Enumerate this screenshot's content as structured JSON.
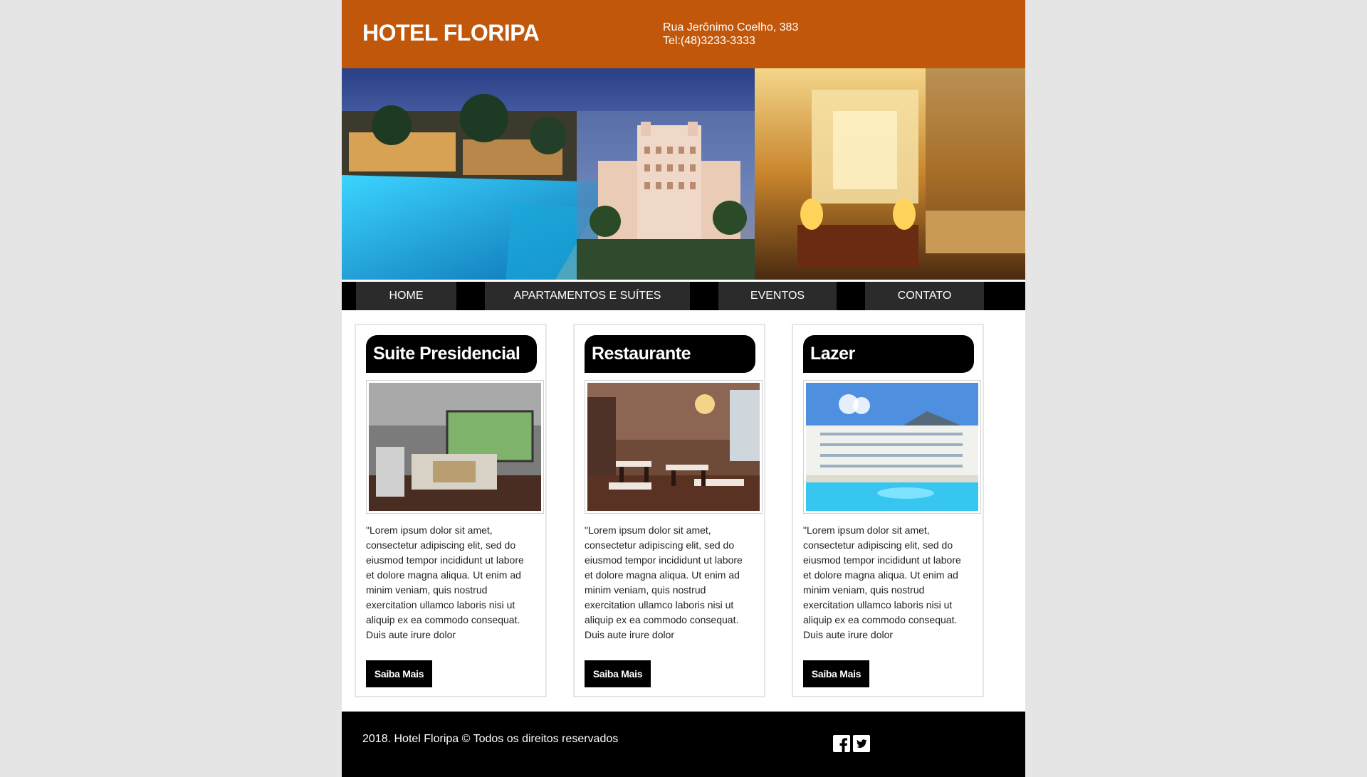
{
  "header": {
    "brand": "HOTEL FLORIPA",
    "address_line1": "Rua Jerônimo Coelho, 383",
    "address_line2": "Tel:(48)3233-3333",
    "bg_color": "#c1570a"
  },
  "nav": {
    "items": [
      {
        "label": "HOME"
      },
      {
        "label": "APARTAMENTOS E SUÍTES"
      },
      {
        "label": "EVENTOS"
      },
      {
        "label": "CONTATO"
      }
    ]
  },
  "cards": [
    {
      "title": "Suite Presidencial",
      "text": "\"Lorem ipsum dolor sit amet, consectetur adipiscing elit, sed do eiusmod tempor incididunt ut labore et dolore magna aliqua. Ut enim ad minim veniam, quis nostrud exercitation ullamco laboris nisi ut aliquip ex ea commodo consequat. Duis aute irure dolor",
      "button": "Saiba Mais"
    },
    {
      "title": "Restaurante",
      "text": "\"Lorem ipsum dolor sit amet, consectetur adipiscing elit, sed do eiusmod tempor incididunt ut labore et dolore magna aliqua. Ut enim ad minim veniam, quis nostrud exercitation ullamco laboris nisi ut aliquip ex ea commodo consequat. Duis aute irure dolor",
      "button": "Saiba Mais"
    },
    {
      "title": "Lazer",
      "text": "\"Lorem ipsum dolor sit amet, consectetur adipiscing elit, sed do eiusmod tempor incididunt ut labore et dolore magna aliqua. Ut enim ad minim veniam, quis nostrud exercitation ullamco laboris nisi ut aliquip ex ea commodo consequat. Duis aute irure dolor",
      "button": "Saiba Mais"
    }
  ],
  "footer": {
    "copyright": "2018. Hotel Floripa © Todos os direitos reservados",
    "social_icons": [
      "facebook-icon",
      "twitter-icon"
    ]
  }
}
